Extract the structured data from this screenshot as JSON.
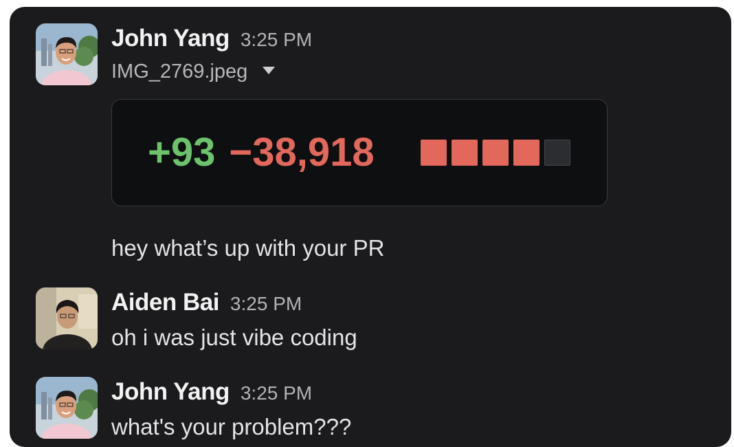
{
  "messages": [
    {
      "author": "John Yang",
      "time": "3:25 PM",
      "attachment": {
        "filename": "IMG_2769.jpeg",
        "caret_icon": "caret-down-icon",
        "diff": {
          "additions": "+93",
          "deletions": "−38,918",
          "addition_color": "#6cc36c",
          "deletion_color": "#e2685c",
          "blocks": [
            "deleted",
            "deleted",
            "deleted",
            "deleted",
            "neutral"
          ],
          "block_colors": {
            "deleted": "#e2685c",
            "neutral": "#2b2d31"
          }
        }
      },
      "text": "hey what’s up with your PR"
    },
    {
      "author": "Aiden Bai",
      "time": "3:25 PM",
      "text": "oh i was just vibe coding"
    },
    {
      "author": "John Yang",
      "time": "3:25 PM",
      "text": "what's your problem???"
    }
  ]
}
